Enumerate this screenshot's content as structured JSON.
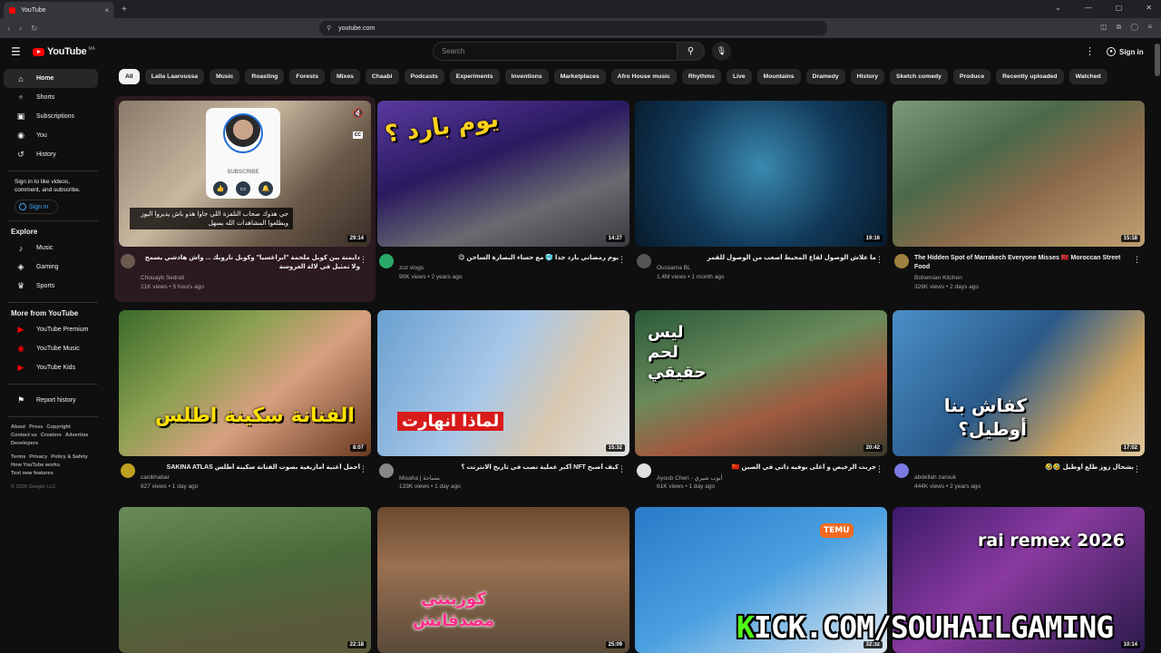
{
  "browser": {
    "tab_title": "YouTube",
    "tab_close": "×",
    "new_tab": "+",
    "url": "youtube.com",
    "win_controls": [
      "⌄",
      "—",
      "▢",
      "✕"
    ]
  },
  "header": {
    "logo_text": "YouTube",
    "country_code": "MA",
    "search_placeholder": "Search",
    "sign_in": "Sign in"
  },
  "sidebar": {
    "main": [
      {
        "label": "Home",
        "icon": "home-icon",
        "glyph": "⌂"
      },
      {
        "label": "Shorts",
        "icon": "shorts-icon",
        "glyph": "ᛜ"
      },
      {
        "label": "Subscriptions",
        "icon": "subscriptions-icon",
        "glyph": "▣"
      },
      {
        "label": "You",
        "icon": "you-icon",
        "glyph": "◉"
      },
      {
        "label": "History",
        "icon": "history-icon",
        "glyph": "↺"
      }
    ],
    "signin_note": "Sign in to like videos, comment, and subscribe.",
    "signin_button": "Sign in",
    "explore_heading": "Explore",
    "explore": [
      {
        "label": "Music",
        "icon": "music-icon",
        "glyph": "♪"
      },
      {
        "label": "Gaming",
        "icon": "gaming-icon",
        "glyph": "◈"
      },
      {
        "label": "Sports",
        "icon": "trophy-icon",
        "glyph": "♛"
      }
    ],
    "more_heading": "More from YouTube",
    "more": [
      {
        "label": "YouTube Premium",
        "icon": "youtube-premium-icon",
        "glyph": "▶"
      },
      {
        "label": "YouTube Music",
        "icon": "youtube-music-icon",
        "glyph": "◉"
      },
      {
        "label": "YouTube Kids",
        "icon": "youtube-kids-icon",
        "glyph": "▶"
      }
    ],
    "report_history": "Report history",
    "footer_line1": [
      "About",
      "Press",
      "Copyright"
    ],
    "footer_line2": [
      "Contact us",
      "Creators",
      "Advertise"
    ],
    "footer_line3": [
      "Developers"
    ],
    "footer_line4": [
      "Terms",
      "Privacy",
      "Policy & Safety"
    ],
    "footer_line5": [
      "How YouTube works"
    ],
    "footer_line6": [
      "Test new features"
    ],
    "copyright": "© 2026 Google LLC"
  },
  "chips": [
    "All",
    "Lalla Laaroussa",
    "Music",
    "Roasting",
    "Forests",
    "Mixes",
    "Chaabi",
    "Podcasts",
    "Experiments",
    "Inventions",
    "Marketplaces",
    "Afro House music",
    "Rhythms",
    "Live",
    "Mountains",
    "Dramedy",
    "History",
    "Sketch comedy",
    "Produce",
    "Recently uploaded",
    "Watched"
  ],
  "hover_card": {
    "subscribe_label": "SUBSCRIBE",
    "caption": "جي هذوك صحاب التلفزة اللي جاوا هذو باش يديروا البوز ويطلعوا المشاهدات الله يسهل"
  },
  "videos": [
    {
      "title": "دايمنة بين كوبل ملحمة \"ابراغسيا\" وكوبل ناروبك ... واش هادشي يسمح ولا تمثيل في لالة العروسة",
      "channel": "Chouayb Sedrati",
      "stats": "21K views • 5 hours ago",
      "duration": "29:14",
      "rtl": true
    },
    {
      "title": "يوم رمضاني بارد جدا 🥶 مع حساء البصارة الساخن 😋",
      "channel": "zoz vlogs",
      "stats": "90K views • 2 years ago",
      "duration": "14:27",
      "rtl": true,
      "thumb_text": "يوم بارد ؟"
    },
    {
      "title": "ما علاش الوصول لقاع المحيط أصعب من الوصول للقمر",
      "channel": "Oussama BL",
      "stats": "1.4M views • 1 month ago",
      "duration": "19:16",
      "rtl": true
    },
    {
      "title": "The Hidden Spot of Marrakech Everyone Misses 🇲🇦 Moroccan Street Food",
      "channel": "Bohemian Kitchen",
      "stats": "326K views • 2 days ago",
      "duration": "15:18",
      "rtl": false
    },
    {
      "title": "أجمل أغنية أمازيغية بصوت الفنانة سكينة أطلس SAKINA ATLAS",
      "channel": "canikhabar",
      "stats": "827 views • 1 day ago",
      "duration": "8:07",
      "rtl": true,
      "thumb_text": "الفنانة سكينة اطلس"
    },
    {
      "title": "كيف أصبح NFT أكبر عملية نصب في تاريخ الانترنت ؟",
      "channel": "Misaha | مساحة",
      "stats": "133K views • 1 day ago",
      "duration": "15:32",
      "rtl": true,
      "thumb_text": "لماذا انهارت"
    },
    {
      "title": "جربت الرخيص و أغلى بوفيه ذاتي في الصين 🇨🇳",
      "channel": "Ayoub Cheri - أيوب شيري",
      "stats": "61K views • 1 day ago",
      "duration": "20:42",
      "rtl": true,
      "thumb_text": "ليس لحم حقيقي"
    },
    {
      "title": "بشحال زوز طلع أوطيل 🤣🤣",
      "channel": "abdellah zarouk",
      "stats": "444K views • 2 years ago",
      "duration": "17:02",
      "rtl": true,
      "thumb_text": "كفاش بنا أوطيل؟"
    },
    {
      "title": "",
      "channel": "",
      "stats": "",
      "duration": "22:18",
      "rtl": false
    },
    {
      "title": "",
      "channel": "",
      "stats": "",
      "duration": "25:09",
      "rtl": false,
      "thumb_text": "كوزينتي مصدقاتش"
    },
    {
      "title": "",
      "channel": "",
      "stats": "",
      "duration": "32:32",
      "rtl": false,
      "thumb_text": "TEMU"
    },
    {
      "title": "",
      "channel": "",
      "stats": "",
      "duration": "10:14",
      "rtl": false,
      "thumb_text": "rai remex 2026"
    }
  ],
  "overlay": {
    "kick_k": "K",
    "kick_rest": "ICK.COM/SOUHAILGAMING"
  },
  "colors": {
    "accent": "#ff0000",
    "link": "#3ea6ff",
    "background": "#0f0f0f"
  }
}
